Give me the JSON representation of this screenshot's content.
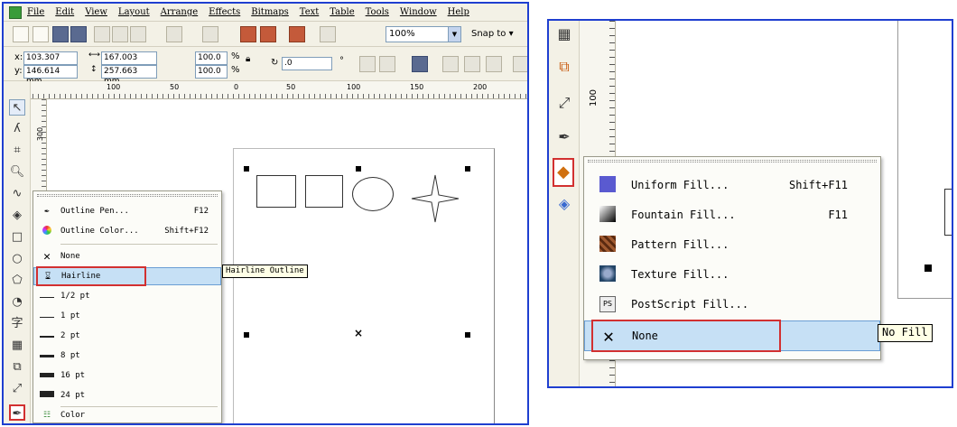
{
  "left": {
    "menu": [
      "File",
      "Edit",
      "View",
      "Layout",
      "Arrange",
      "Effects",
      "Bitmaps",
      "Text",
      "Table",
      "Tools",
      "Window",
      "Help"
    ],
    "toolbar": {
      "zoom_value": "100%",
      "snap_label": "Snap to"
    },
    "properties": {
      "x_value": "103.307 mm",
      "y_value": "146.614 mm",
      "x_label": "x:",
      "y_label": "y:",
      "width_value": "167.003 mm",
      "height_value": "257.663 mm",
      "scale_x": "100.0",
      "scale_y": "100.0",
      "percent_1": "%",
      "percent_2": "%",
      "rotation_value": ".0",
      "degree": "°"
    },
    "ruler": {
      "h_ticks": [
        "100",
        "50",
        "0",
        "50",
        "100",
        "150",
        "200"
      ],
      "v_tick": "300"
    },
    "outline_flyout": {
      "items": [
        {
          "icon": "pen-nib-icon",
          "label": "Outline Pen...",
          "shortcut": "F12"
        },
        {
          "icon": "color-wheel-icon",
          "label": "Outline Color...",
          "shortcut": "Shift+F12"
        },
        {
          "icon": "x-icon",
          "label": "None",
          "shortcut": ""
        },
        {
          "icon": "hairline-icon",
          "label": "Hairline",
          "shortcut": ""
        },
        {
          "icon": "line-half-pt-icon",
          "label": "1/2 pt",
          "shortcut": ""
        },
        {
          "icon": "line-1pt-icon",
          "label": "1 pt",
          "shortcut": ""
        },
        {
          "icon": "line-2pt-icon",
          "label": "2 pt",
          "shortcut": ""
        },
        {
          "icon": "line-8pt-icon",
          "label": "8 pt",
          "shortcut": ""
        },
        {
          "icon": "line-16pt-icon",
          "label": "16 pt",
          "shortcut": ""
        },
        {
          "icon": "line-24pt-icon",
          "label": "24 pt",
          "shortcut": ""
        },
        {
          "icon": "color-palette-icon",
          "label": "Color",
          "shortcut": ""
        }
      ],
      "tooltip": "Hairline Outline"
    }
  },
  "right": {
    "ruler_v_tick": "100",
    "fill_flyout": {
      "items": [
        {
          "icon": "uniform-fill-icon",
          "label": "Uniform Fill...",
          "shortcut": "Shift+F11"
        },
        {
          "icon": "fountain-fill-icon",
          "label": "Fountain Fill...",
          "shortcut": "F11"
        },
        {
          "icon": "pattern-fill-icon",
          "label": "Pattern Fill...",
          "shortcut": ""
        },
        {
          "icon": "texture-fill-icon",
          "label": "Texture Fill...",
          "shortcut": ""
        },
        {
          "icon": "postscript-fill-icon",
          "label": "PostScript Fill...",
          "shortcut": ""
        },
        {
          "icon": "x-icon",
          "label": "None",
          "shortcut": ""
        }
      ],
      "postscript_icon_text": "PS",
      "tooltip": "No Fill"
    }
  },
  "colors": {
    "frame_border": "#1f3fd0",
    "highlight": "#c6e0f5",
    "selection_outline": "#d23030"
  }
}
